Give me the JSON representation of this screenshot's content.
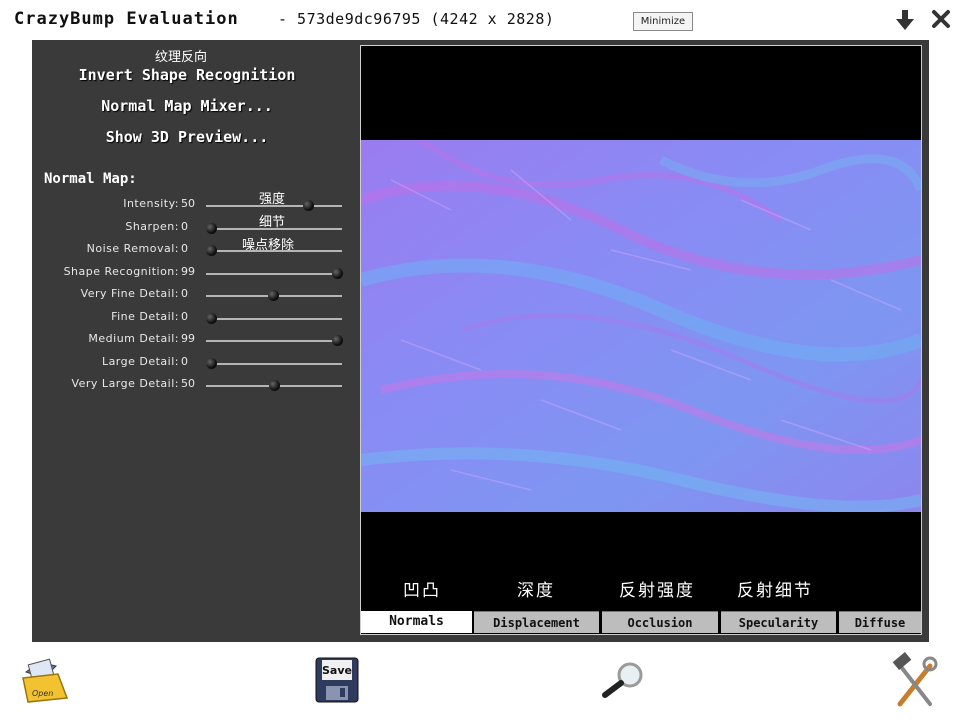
{
  "window": {
    "app_title": "CrazyBump Evaluation",
    "file_info": "- 573de9dc96795 (4242 x 2828)",
    "minimize_label": "Minimize"
  },
  "sidebar": {
    "invert_cn": "纹理反向",
    "invert_shape_label": "Invert Shape Recognition",
    "mixer_label": "Normal Map Mixer...",
    "preview_label": "Show 3D Preview...",
    "section_title": "Normal Map:",
    "annotations": [
      "强度",
      "细节",
      "噪点移除"
    ],
    "sliders": [
      {
        "label": "Intensity:",
        "value": "50",
        "level": 0.75
      },
      {
        "label": "Sharpen:",
        "value": "0",
        "level": 0.04
      },
      {
        "label": "Noise Removal:",
        "value": "0",
        "level": 0.04
      },
      {
        "label": "Shape Recognition:",
        "value": "99",
        "level": 0.96
      },
      {
        "label": "Very Fine Detail:",
        "value": "0",
        "level": 0.49
      },
      {
        "label": "Fine Detail:",
        "value": "0",
        "level": 0.04
      },
      {
        "label": "Medium Detail:",
        "value": "99",
        "level": 0.96
      },
      {
        "label": "Large Detail:",
        "value": "0",
        "level": 0.04
      },
      {
        "label": "Very Large Detail:",
        "value": "50",
        "level": 0.5
      }
    ]
  },
  "viewer": {
    "cn_tabs": [
      "凹凸",
      "深度",
      "反射强度",
      "反射细节"
    ],
    "tabs": [
      {
        "label": "Normals",
        "active": true
      },
      {
        "label": "Displacement",
        "active": false
      },
      {
        "label": "Occlusion",
        "active": false
      },
      {
        "label": "Specularity",
        "active": false
      },
      {
        "label": "Diffuse",
        "active": false
      }
    ]
  },
  "toolbar": {
    "open_label": "Open",
    "save_label": "Save"
  },
  "icons": [
    "download-icon",
    "close-icon",
    "open-folder-icon",
    "save-disk-icon",
    "magnifier-icon",
    "tools-icon"
  ],
  "colors": {
    "panel_bg": "#3a3a3a",
    "normal_map_base": "#8a86f2",
    "tab_active": "#ffffff",
    "tab_inactive": "#bdbdbd"
  }
}
